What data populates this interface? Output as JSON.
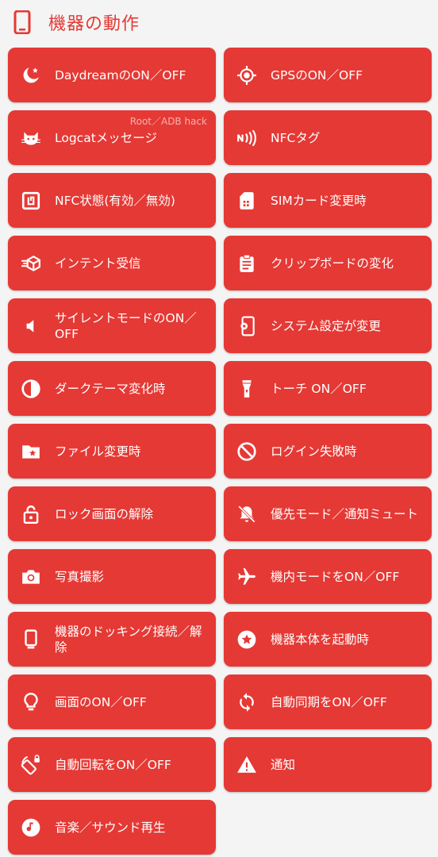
{
  "header": {
    "title": "機器の動作",
    "icon": "device-icon"
  },
  "tiles": [
    {
      "label": "DaydreamのON／OFF",
      "icon": "daydream-icon"
    },
    {
      "label": "GPSのON／OFF",
      "icon": "gps-icon"
    },
    {
      "label": "Logcatメッセージ",
      "icon": "cat-icon",
      "badge": "Root／ADB hack"
    },
    {
      "label": "NFCタグ",
      "icon": "nfc-tag-icon"
    },
    {
      "label": "NFC状態(有効／無効)",
      "icon": "nfc-icon"
    },
    {
      "label": "SIMカード変更時",
      "icon": "sim-card-icon"
    },
    {
      "label": "インテント受信",
      "icon": "intent-icon"
    },
    {
      "label": "クリップボードの変化",
      "icon": "clipboard-icon"
    },
    {
      "label": "サイレントモードのON／OFF",
      "icon": "speaker-icon"
    },
    {
      "label": "システム設定が変更",
      "icon": "settings-phone-icon"
    },
    {
      "label": "ダークテーマ変化時",
      "icon": "contrast-icon"
    },
    {
      "label": "トーチ ON／OFF",
      "icon": "flashlight-icon"
    },
    {
      "label": "ファイル変更時",
      "icon": "folder-star-icon"
    },
    {
      "label": "ログイン失敗時",
      "icon": "block-icon"
    },
    {
      "label": "ロック画面の解除",
      "icon": "unlock-icon"
    },
    {
      "label": "優先モード／通知ミュート",
      "icon": "bell-off-icon"
    },
    {
      "label": "写真撮影",
      "icon": "camera-icon"
    },
    {
      "label": "機内モードをON／OFF",
      "icon": "airplane-icon"
    },
    {
      "label": "機器のドッキング接続／解除",
      "icon": "dock-icon"
    },
    {
      "label": "機器本体を起動時",
      "icon": "star-circle-icon"
    },
    {
      "label": "画面のON／OFF",
      "icon": "lightbulb-icon"
    },
    {
      "label": "自動同期をON／OFF",
      "icon": "sync-icon"
    },
    {
      "label": "自動回転をON／OFF",
      "icon": "rotation-icon"
    },
    {
      "label": "通知",
      "icon": "warning-icon"
    },
    {
      "label": "音楽／サウンド再生",
      "icon": "music-icon"
    }
  ]
}
